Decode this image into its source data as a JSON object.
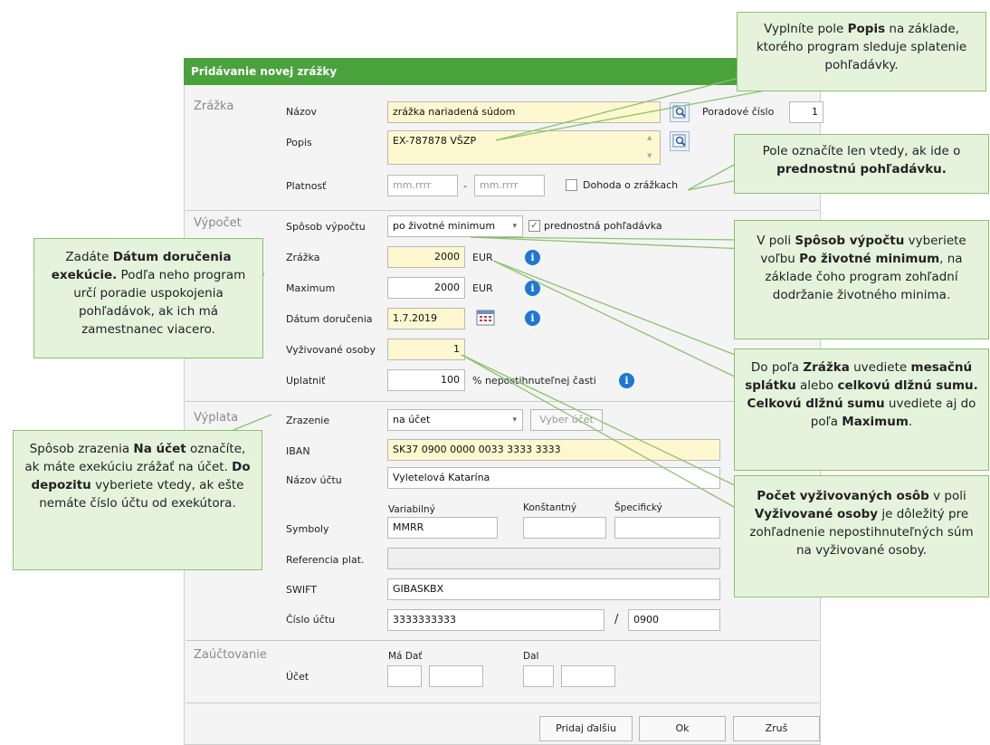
{
  "dialog": {
    "title": "Pridávanie novej zrážky",
    "sections": {
      "zrazka": "Zrážka",
      "vypocet": "Výpočet",
      "vyplata": "Výplata",
      "zauctovanie": "Zaúčtovanie"
    }
  },
  "zrazka": {
    "nazov_label": "Názov",
    "nazov_value": "zrážka nariadená súdom",
    "poradove_label": "Poradové číslo",
    "poradove_value": "1",
    "popis_label": "Popis",
    "popis_value": "EX-787878 VŠZP",
    "platnost_label": "Platnosť",
    "platnost_from_placeholder": "mm.rrrr",
    "platnost_dash": "-",
    "platnost_to_placeholder": "mm.rrrr",
    "dohoda_label": "Dohoda o zrážkach",
    "dohoda_checked": false
  },
  "vypocet": {
    "sposob_label": "Spôsob výpočtu",
    "sposob_value": "po životné minimum",
    "prednostna_label": "prednostná pohľadávka",
    "prednostna_checked": true,
    "zrazka_label": "Zrážka",
    "zrazka_value": "2000",
    "zrazka_unit": "EUR",
    "maximum_label": "Maximum",
    "maximum_value": "2000",
    "maximum_unit": "EUR",
    "datum_label": "Dátum doručenia",
    "datum_value": "1.7.2019",
    "vyzivovane_label": "Vyživované osoby",
    "vyzivovane_value": "1",
    "uplatnit_label": "Uplatniť",
    "uplatnit_value": "100",
    "uplatnit_suffix": "% nepostihnuteľnej časti"
  },
  "vyplata": {
    "zrazenie_label": "Zrazenie",
    "zrazenie_value": "na účet",
    "vyber_ucet_label": "Vyber účet",
    "iban_label": "IBAN",
    "iban_value": "SK37 0900 0000 0033 3333 3333",
    "nazov_uctu_label": "Názov účtu",
    "nazov_uctu_value": "Vyletelová Katarína",
    "variabilny_label": "Variabilný",
    "konstantny_label": "Konštantný",
    "specificky_label": "Špecifický",
    "symboly_label": "Symboly",
    "variabilny_value": "MMRR",
    "konstantny_value": "",
    "specificky_value": "",
    "referencia_label": "Referencia plat.",
    "referencia_value": "",
    "swift_label": "SWIFT",
    "swift_value": "GIBASKBX",
    "cislo_uctu_label": "Číslo účtu",
    "cislo_uctu_value": "3333333333",
    "slash": "/",
    "kod_banky_value": "0900"
  },
  "zauctovanie": {
    "ma_dat_label": "Má Dať",
    "dal_label": "Dal",
    "ucet_label": "Účet"
  },
  "buttons": {
    "pridaj_dalsiu": "Pridaj ďalšiu",
    "ok": "Ok",
    "zrus": "Zruš"
  },
  "callouts": {
    "popis": {
      "t1": "Vyplníte pole ",
      "b1": "Popis",
      "t2": " na základe, ktorého program sleduje splatenie pohľadávky."
    },
    "prednostna": {
      "t1": "Pole označíte len vtedy, ak ide o ",
      "b1": "prednostnú pohľadávku."
    },
    "sposob": {
      "t1": "V poli ",
      "b1": "Spôsob výpočtu",
      "t2": " vyberiete voľbu ",
      "b2": "Po životné minimum",
      "t3": ", na základe čoho program zohľadní dodržanie životného minima."
    },
    "datum": {
      "t1": "Zadáte ",
      "b1": "Dátum doručenia exekúcie.",
      "t2": " Podľa neho program určí poradie uspokojenia pohľadávok, ak ich má zamestnanec viacero."
    },
    "zrazka": {
      "t1": "Do poľa ",
      "b1": "Zrážka",
      "t2": " uvediete ",
      "b2": "mesačnú splátku",
      "t3": " alebo ",
      "b3": "celkovú dlžnú sumu. Celkovú dlžnú sumu",
      "t4": " uvediete aj do poľa ",
      "b4": "Maximum",
      "t5": "."
    },
    "vyzivovane": {
      "b1": "Počet vyživovaných osôb",
      "t1": " v poli ",
      "b2": "Vyživované osoby",
      "t2": " je dôležitý pre zohľadnenie nepostihnuteľných súm na vyživované osoby."
    },
    "zrazenie": {
      "t1": "Spôsob zrazenia ",
      "b1": "Na účet",
      "t2": " označíte, ak máte exekúciu zrážať na účet. ",
      "b2": "Do depozitu",
      "t3": " vyberiete vtedy, ak ešte nemáte číslo účtu od exekútora."
    }
  },
  "colors": {
    "titlebar": "#4aa23d",
    "callout_bg": "#e6f3dc",
    "callout_border": "#8cc26b",
    "highlight_field": "#fdf8d0",
    "info": "#1e78d2"
  }
}
